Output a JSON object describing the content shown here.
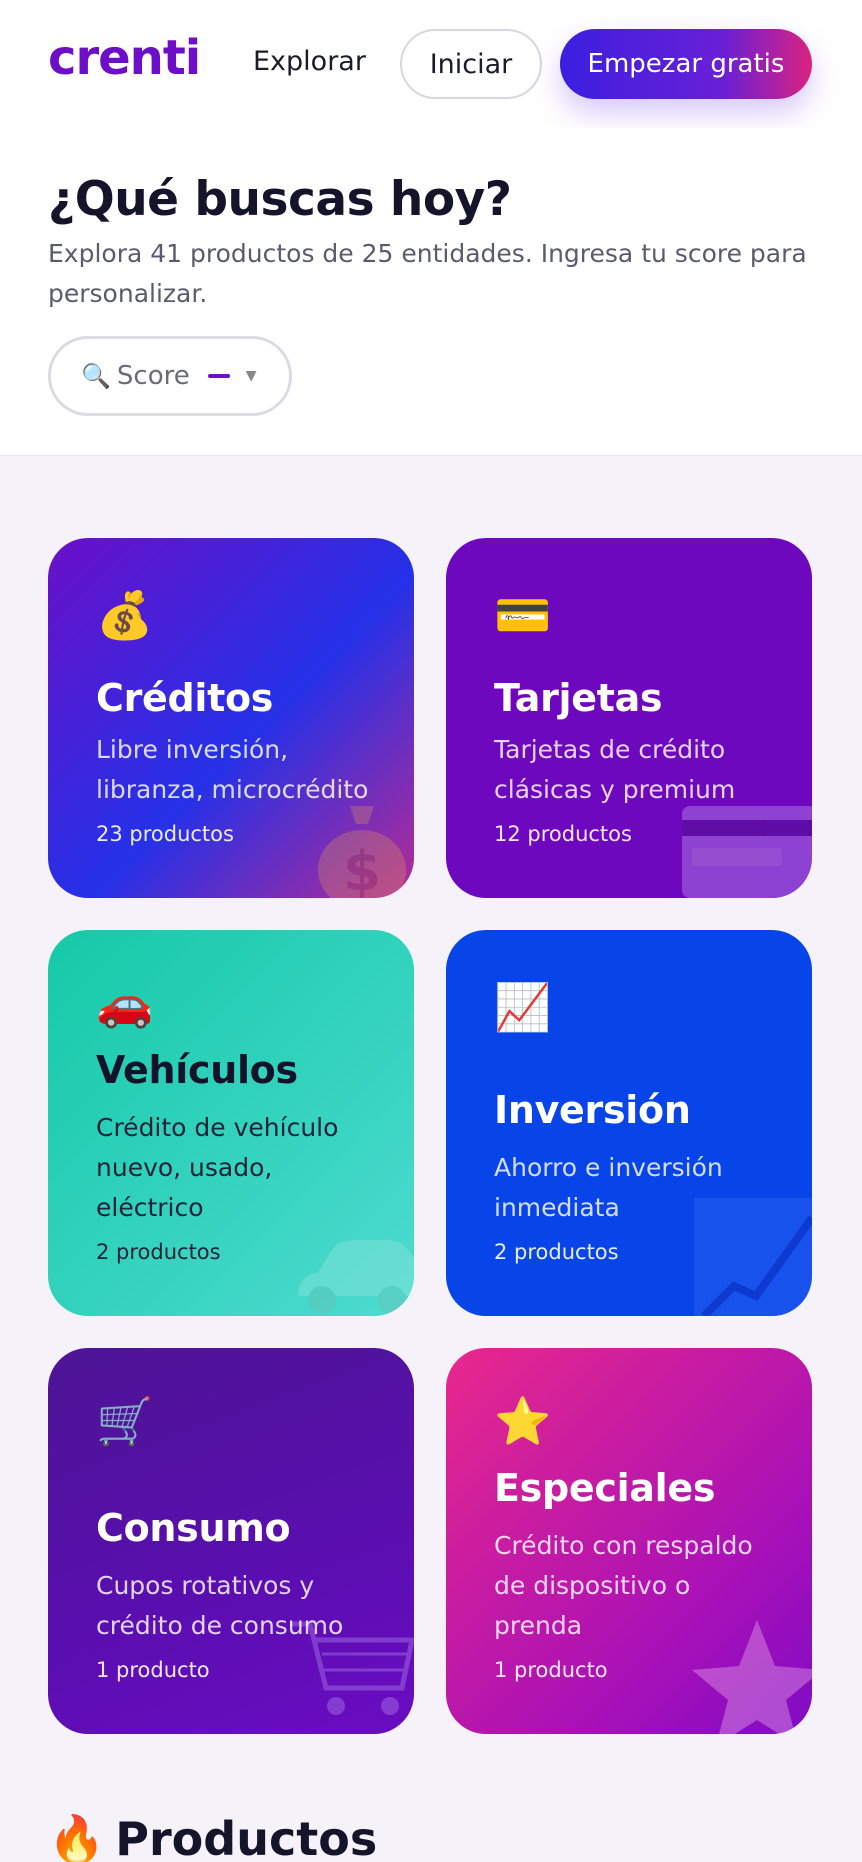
{
  "header": {
    "logo": "crenti",
    "nav_explore": "Explorar",
    "login_label": "Iniciar",
    "cta_label": "Empezar gratis"
  },
  "search": {
    "title": "¿Qué buscas hoy?",
    "subtitle": "Explora 41 productos de 25 entidades. Ingresa tu score para personalizar.",
    "score_label": "Score"
  },
  "categories": [
    {
      "emoji": "💰",
      "title": "Créditos",
      "desc": "Libre inversión, libranza, microcrédito",
      "count": "23 productos",
      "icon": "money-bag-icon"
    },
    {
      "emoji": "💳",
      "title": "Tarjetas",
      "desc": "Tarjetas de crédito clásicas y premium",
      "count": "12 productos",
      "icon": "credit-card-icon"
    },
    {
      "emoji": "🚗",
      "title": "Vehículos",
      "desc": "Crédito de vehículo nuevo, usado, eléctrico",
      "count": "2 productos",
      "icon": "car-icon"
    },
    {
      "emoji": "📈",
      "title": "Inversión",
      "desc": "Ahorro e inversión inmediata",
      "count": "2 productos",
      "icon": "chart-up-icon"
    },
    {
      "emoji": "🛒",
      "title": "Consumo",
      "desc": "Cupos rotativos y crédito de consumo",
      "count": "1 producto",
      "icon": "shopping-cart-icon"
    },
    {
      "emoji": "⭐",
      "title": "Especiales",
      "desc": "Crédito con respaldo de dispositivo o prenda",
      "count": "1 producto",
      "icon": "star-icon"
    }
  ],
  "products": {
    "emoji": "🔥",
    "heading": "Productos"
  },
  "colors": {
    "brand": "#6d0fc9",
    "creditos": "#2531e8",
    "tarjetas": "#6e08bf",
    "vehiculos": "#16c9a8",
    "inversion": "#0745e8",
    "consumo": "#5a0eb0",
    "especiales": "#e8288c"
  }
}
